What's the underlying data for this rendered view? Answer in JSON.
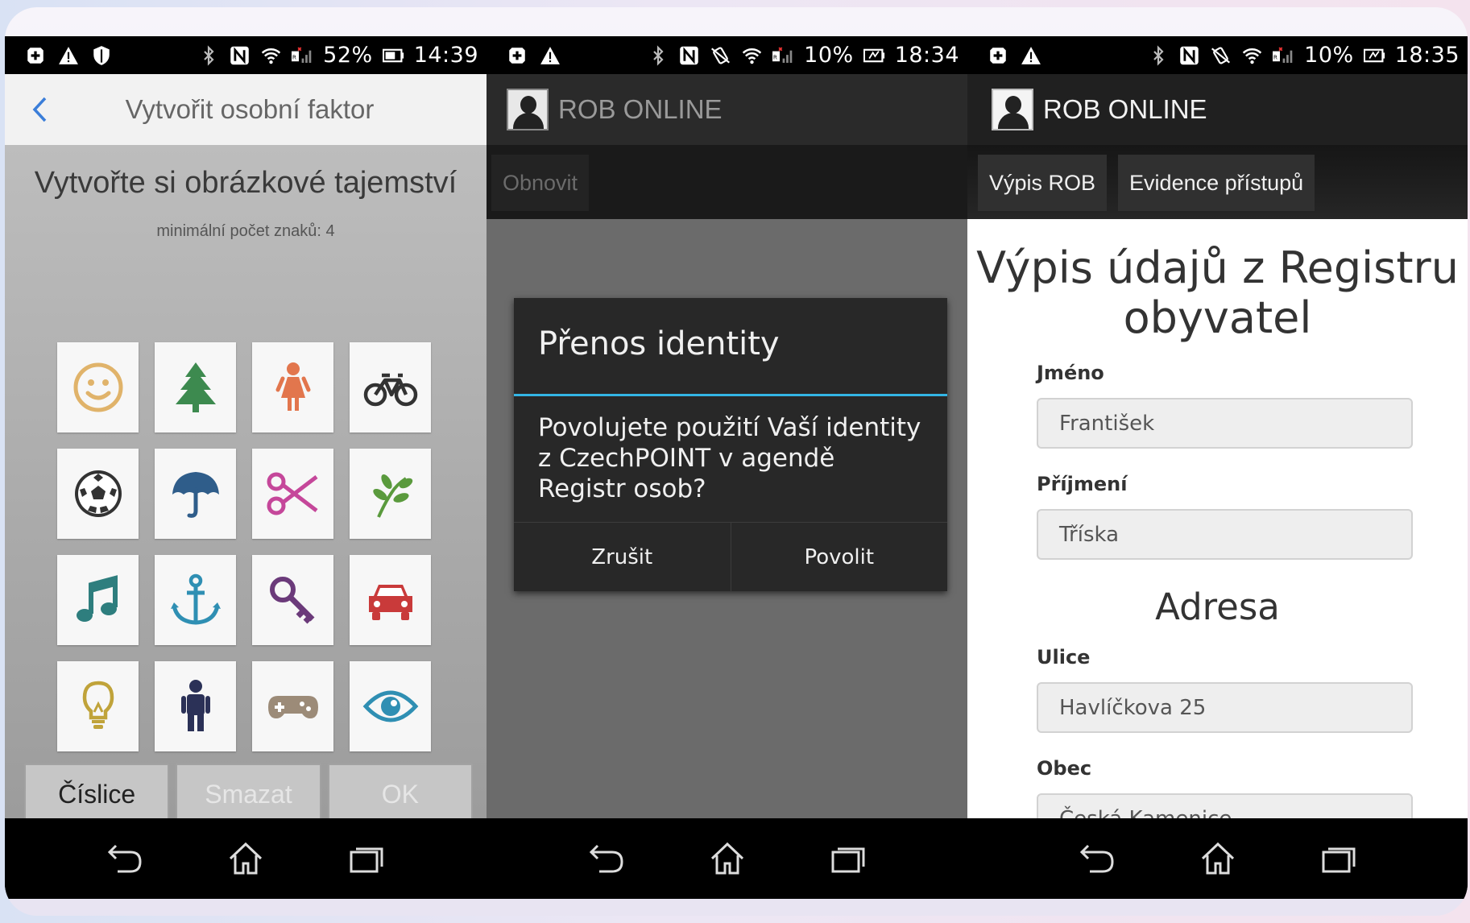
{
  "screens": [
    {
      "status": {
        "battery": "52%",
        "time": "14:39"
      },
      "title": "Vytvořit osobní faktor",
      "headline": "Vytvořte si obrázkové tajemství",
      "subline": "minimální počet znaků: 4",
      "icons": [
        "smiley-icon",
        "tree-icon",
        "girl-icon",
        "bicycle-icon",
        "football-icon",
        "umbrella-icon",
        "scissors-icon",
        "plant-icon",
        "music-note-icon",
        "anchor-icon",
        "key-icon",
        "car-icon",
        "lightbulb-icon",
        "man-icon",
        "gamepad-icon",
        "eye-icon"
      ],
      "buttons": {
        "digits": "Číslice",
        "delete": "Smazat",
        "ok": "OK"
      }
    },
    {
      "status": {
        "battery": "10%",
        "time": "18:34"
      },
      "app_title": "ROB ONLINE",
      "tab": "Obnovit",
      "dialog": {
        "title": "Přenos identity",
        "message": "Povolujete použití Vaší identity z CzechPOINT v agendě Registr osob?",
        "cancel": "Zrušit",
        "allow": "Povolit"
      }
    },
    {
      "status": {
        "battery": "10%",
        "time": "18:35"
      },
      "app_title": "ROB ONLINE",
      "tabs": [
        "Výpis ROB",
        "Evidence přístupů"
      ],
      "page_title": "Výpis údajů z Registru obyvatel",
      "fields": {
        "first_name_label": "Jméno",
        "first_name": "František",
        "last_name_label": "Příjmení",
        "last_name": "Tříska",
        "address_heading": "Adresa",
        "street_label": "Ulice",
        "street": "Havlíčkova 25",
        "city_label": "Obec",
        "city": "Česká Kamenice"
      }
    }
  ],
  "colors": {
    "accent_blue": "#33b5e5",
    "dialog_bg": "#282828",
    "field_bg": "#eeeeee"
  }
}
